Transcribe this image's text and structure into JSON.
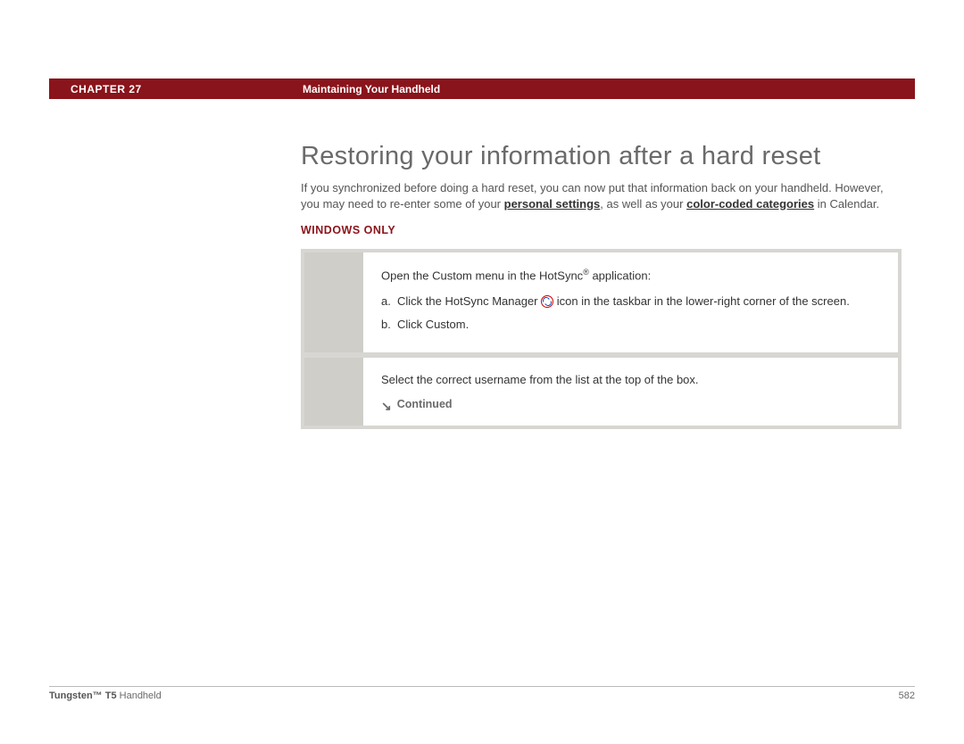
{
  "header": {
    "chapter_label": "CHAPTER 27",
    "section_title": "Maintaining Your Handheld"
  },
  "main": {
    "title": "Restoring your information after a hard reset",
    "intro_pre": "If you synchronized before doing a hard reset, you can now put that information back on your handheld. However, you may need to re-enter some of your ",
    "intro_link1": "personal settings",
    "intro_mid": ", as well as your ",
    "intro_link2": "color-coded categories",
    "intro_post": " in Calendar.",
    "subheading": "WINDOWS ONLY",
    "steps": {
      "step1": {
        "lead_pre": "Open the Custom menu in the HotSync",
        "lead_post": " application:",
        "a_marker": "a.",
        "a_pre": "Click the HotSync Manager ",
        "a_post": " icon in the taskbar in the lower-right corner of the screen.",
        "b_marker": "b.",
        "b_text": "Click Custom."
      },
      "step2": {
        "text": "Select the correct username from the list at the top of the box.",
        "continued_label": "Continued"
      }
    }
  },
  "footer": {
    "product_bold": "Tungsten™ T5",
    "product_rest": " Handheld",
    "page_number": "582"
  }
}
